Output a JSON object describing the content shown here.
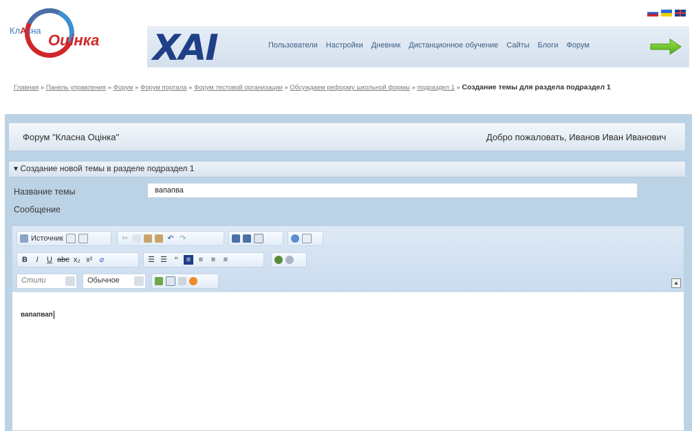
{
  "logo": {
    "small_left": "Кл",
    "small_mid": "А",
    "small_right": "сна",
    "big": "Оцінка"
  },
  "brand": {
    "xai": "ХАІ"
  },
  "flags": [
    "flag-ru",
    "flag-ua",
    "flag-gb"
  ],
  "nav": {
    "items": [
      "Пользователи",
      "Настройки",
      "Дневник",
      "Дистанционное обучение",
      "Сайты",
      "Блоги",
      "Форум"
    ],
    "arrow_icon": "next-arrow-icon"
  },
  "breadcrumb": {
    "links": [
      "Главная",
      "Панель управления",
      "Форум",
      "Форум портала",
      "Форум тестовой организации",
      "Обсуждаем реформу школьной формы",
      "подраздел 1"
    ],
    "separator": "»",
    "current": "Создание темы для раздела подраздел 1"
  },
  "forum": {
    "title": "Форум \"Класна Оцінка\"",
    "welcome": "Добро пожаловать, Иванов Иван Иванович"
  },
  "section": {
    "title": "▾ Создание новой темы в разделе подраздел 1"
  },
  "form": {
    "topic_label": "Название темы",
    "topic_value": "вапапва",
    "message_label": "Сообщение"
  },
  "editor": {
    "source_label": "Источник",
    "style_select": "Стили",
    "format_select": "Обычное",
    "content": "вапапвап",
    "collapse_label": "▴"
  },
  "colors": {
    "accent": "#d0272a",
    "brand_blue": "#1f3f86",
    "frame": "#bcd3e6"
  }
}
